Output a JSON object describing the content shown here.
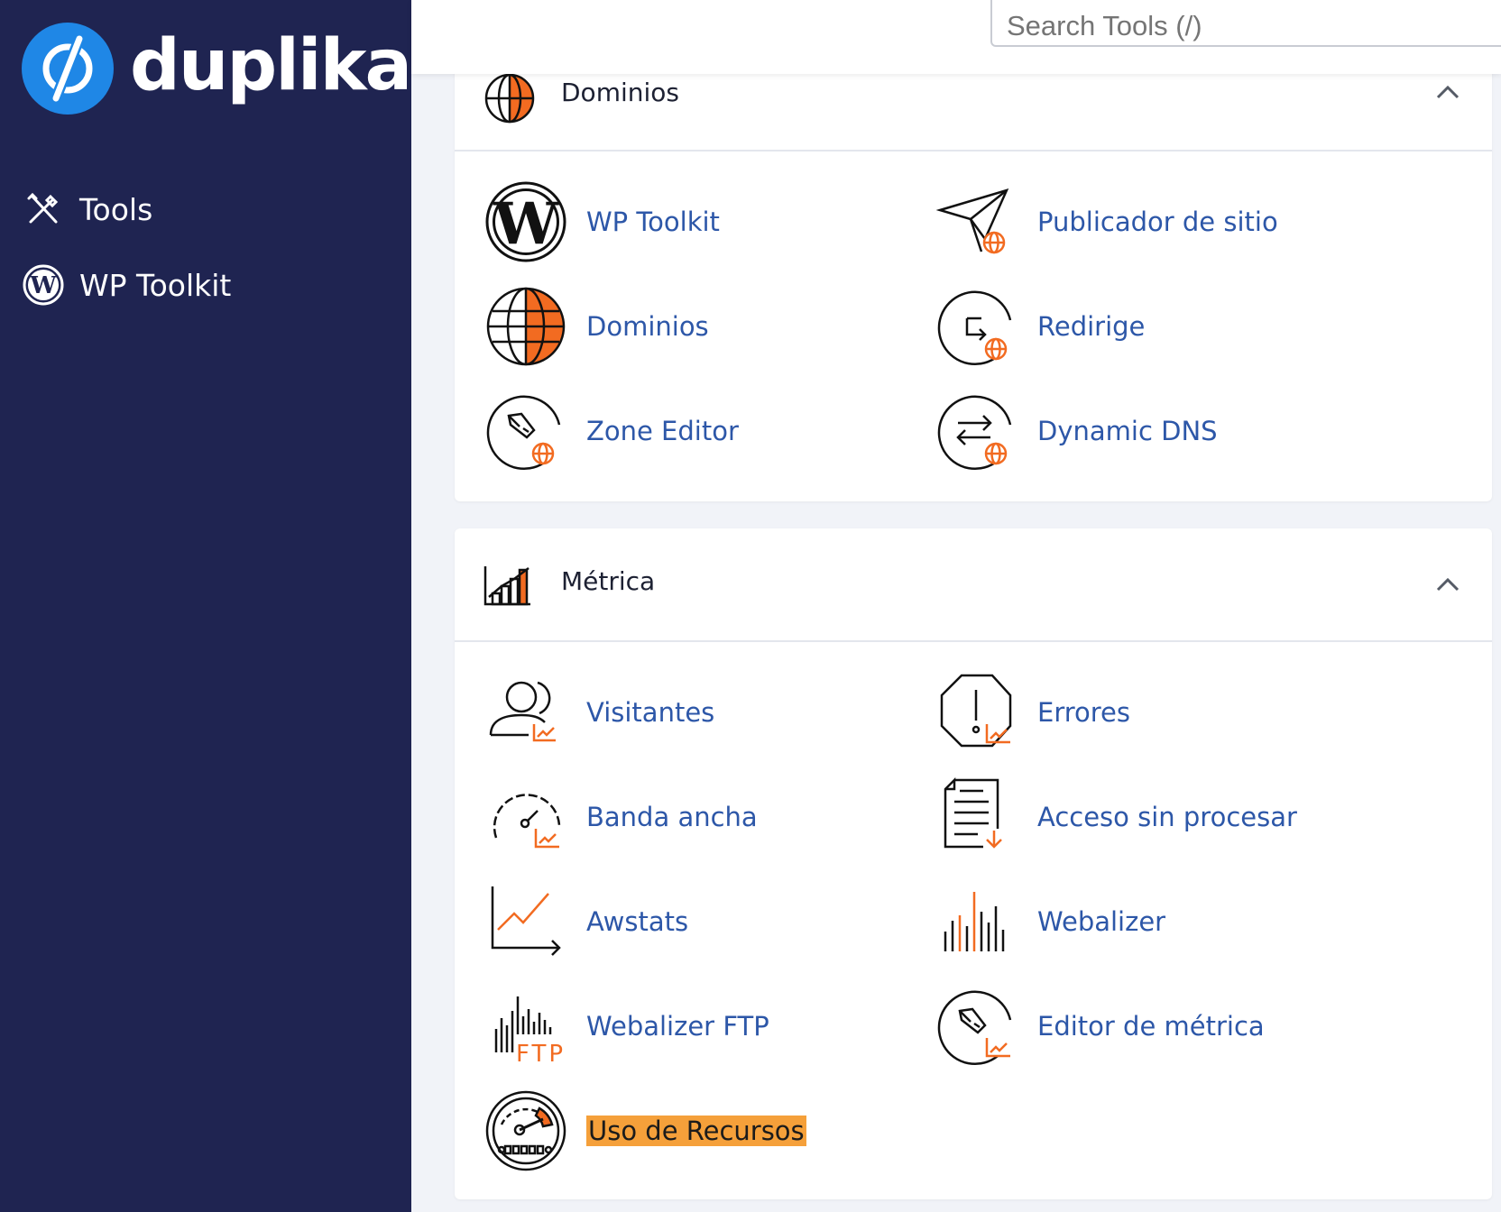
{
  "brand": {
    "name": "duplika",
    "accent": "#1f87e6",
    "sidebar_bg": "#1f2451"
  },
  "sidebar": {
    "items": [
      {
        "label": "Tools",
        "icon": "tools-icon"
      },
      {
        "label": "WP Toolkit",
        "icon": "wordpress-icon"
      }
    ]
  },
  "search": {
    "placeholder": "Search Tools (/)"
  },
  "sections": [
    {
      "title": "Dominios",
      "icon": "globe-icon",
      "expanded": true,
      "tools": [
        {
          "label": "WP Toolkit",
          "icon": "wordpress-icon"
        },
        {
          "label": "Publicador de sitio",
          "icon": "paper-plane-icon"
        },
        {
          "label": "Dominios",
          "icon": "globe-icon"
        },
        {
          "label": "Redirige",
          "icon": "redirect-icon"
        },
        {
          "label": "Zone Editor",
          "icon": "pen-icon"
        },
        {
          "label": "Dynamic DNS",
          "icon": "swap-arrows-icon"
        }
      ]
    },
    {
      "title": "Métrica",
      "icon": "bar-chart-icon",
      "expanded": true,
      "tools": [
        {
          "label": "Visitantes",
          "icon": "user-chart-icon"
        },
        {
          "label": "Errores",
          "icon": "warning-octagon-icon"
        },
        {
          "label": "Banda ancha",
          "icon": "gauge-icon"
        },
        {
          "label": "Acceso sin procesar",
          "icon": "document-download-icon"
        },
        {
          "label": "Awstats",
          "icon": "line-chart-icon"
        },
        {
          "label": "Webalizer",
          "icon": "bars-icon"
        },
        {
          "label": "Webalizer FTP",
          "icon": "ftp-bars-icon",
          "icon_text": "FTP"
        },
        {
          "label": "Editor de métrica",
          "icon": "pen-chart-icon"
        },
        {
          "label": "Uso de Recursos",
          "icon": "speedometer-icon",
          "highlighted": true
        }
      ]
    }
  ],
  "colors": {
    "link": "#2d57a8",
    "icon_accent": "#f26b21",
    "highlight": "#f5a03a"
  }
}
